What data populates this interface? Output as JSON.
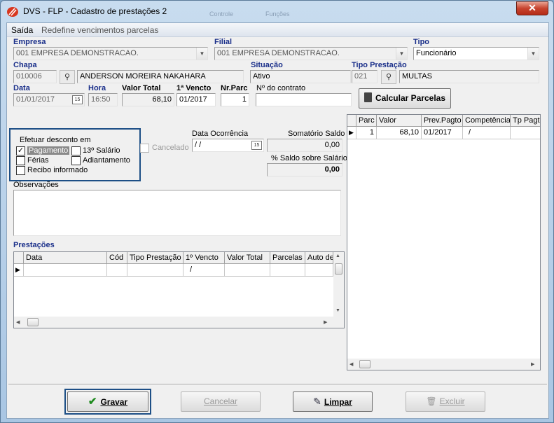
{
  "window": {
    "title": "DVS - FLP - Cadastro de prestações 2",
    "ghost_labels": [
      "Controle",
      "Funções"
    ]
  },
  "menu": {
    "items": [
      "Saída",
      "Redefine vencimentos parcelas"
    ]
  },
  "form": {
    "empresa": {
      "label": "Empresa",
      "value": "001 EMPRESA DEMONSTRACAO."
    },
    "filial": {
      "label": "Filial",
      "value": "001 EMPRESA DEMONSTRACAO."
    },
    "tipo": {
      "label": "Tipo",
      "value": "Funcionário"
    },
    "chapa": {
      "label": "Chapa",
      "value": "010006",
      "name": "ANDERSON MOREIRA NAKAHARA"
    },
    "situacao": {
      "label": "Situação",
      "value": "Ativo"
    },
    "tipo_prestacao": {
      "label": "Tipo Prestação",
      "code": "021",
      "name": "MULTAS"
    },
    "data": {
      "label": "Data",
      "value": "01/01/2017"
    },
    "hora": {
      "label": "Hora",
      "value": "16:50"
    },
    "valor_total": {
      "label": "Valor Total",
      "value": "68,10"
    },
    "primeiro_vencto": {
      "label": "1ª Vencto",
      "value": "01/2017"
    },
    "nr_parc": {
      "label": "Nr.Parc",
      "value": "1"
    },
    "nr_contrato": {
      "label": "Nº do contrato",
      "value": ""
    },
    "calcular_label": "Calcular Parcelas",
    "efetuar": {
      "title": "Efetuar desconto em",
      "options": [
        {
          "label": "Pagamento",
          "checked": true
        },
        {
          "label": "13º Salário",
          "checked": false
        },
        {
          "label": "Férias",
          "checked": false
        },
        {
          "label": "Adiantamento",
          "checked": false
        },
        {
          "label": "Recibo informado",
          "checked": false
        }
      ]
    },
    "cancelado_label": "Cancelado",
    "data_ocorrencia": {
      "label": "Data Ocorrência",
      "value": " /  /"
    },
    "somatorio_saldo": {
      "label": "Somatório Saldo",
      "value": "0,00"
    },
    "saldo_salario": {
      "label": "% Saldo sobre Salário",
      "value": "0,00"
    },
    "observacoes_label": "Observações",
    "prestacoes_label": "Prestações"
  },
  "parcelas_grid": {
    "columns": [
      "Parc",
      "Valor",
      "Prev.Pagto",
      "Competência",
      "Tp Pagt"
    ],
    "rows": [
      [
        "1",
        "68,10",
        "01/2017",
        "/",
        ""
      ]
    ]
  },
  "prestacoes_grid": {
    "columns": [
      "Data",
      "Cód",
      "Tipo Prestação",
      "1º Vencto",
      "Valor Total",
      "Parcelas",
      "Auto de"
    ],
    "rows": [
      [
        "",
        "",
        "",
        "/",
        "",
        "",
        ""
      ]
    ]
  },
  "buttons": {
    "gravar": {
      "label": "Gravar",
      "enabled": true
    },
    "cancelar": {
      "label": "Cancelar",
      "enabled": false
    },
    "limpar": {
      "label": "Limpar",
      "enabled": true
    },
    "excluir": {
      "label": "Excluir",
      "enabled": false
    }
  },
  "colors": {
    "label_blue": "#1a2f8a",
    "focus_border": "#1d4f86",
    "close_red": "#c7432e"
  }
}
